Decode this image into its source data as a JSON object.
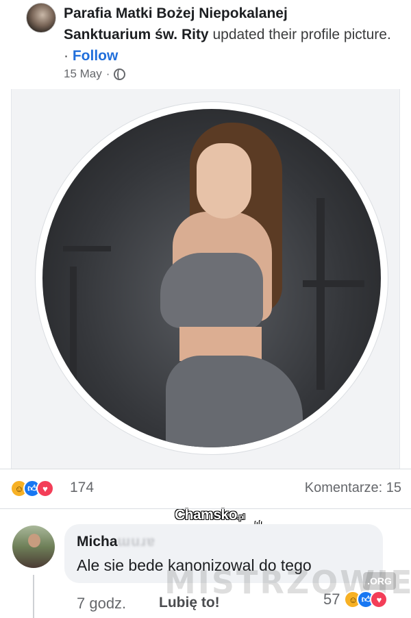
{
  "post": {
    "page_name_line1": "Parafia  Matki Bożej Niepokalanej",
    "page_name_line2": "Sanktuarium św. Rity",
    "action": "updated their profile picture.",
    "separator": " · ",
    "follow_label": "Follow",
    "date": "15 May",
    "date_separator": "·",
    "privacy_icon": "globe-icon"
  },
  "photo": {
    "watermark": "Chamsko",
    "watermark_suffix": ".pl",
    "watermark_mark": "#"
  },
  "reactions": {
    "icons": [
      "haha-icon",
      "like-icon",
      "love-icon"
    ],
    "count": "174",
    "comments_label": "Komentarze: 15"
  },
  "comment": {
    "author_visible": "Micha",
    "author_blurred": "ɯuɹɐ",
    "text": "Ale sie bede kanonizowal do tego",
    "time": "7 godz.",
    "like_label": "Lubię to!",
    "reaction_count": "57",
    "reaction_icons": [
      "haha-icon",
      "like-icon",
      "love-icon"
    ]
  },
  "site_watermark": {
    "text": "MISTRZOWIE",
    "suffix": ".ORG"
  },
  "colors": {
    "link_blue": "#216fdb",
    "like_blue": "#1877f2",
    "love_red": "#f33e58",
    "haha_yellow": "#f7b125",
    "meta_gray": "#65676b"
  }
}
